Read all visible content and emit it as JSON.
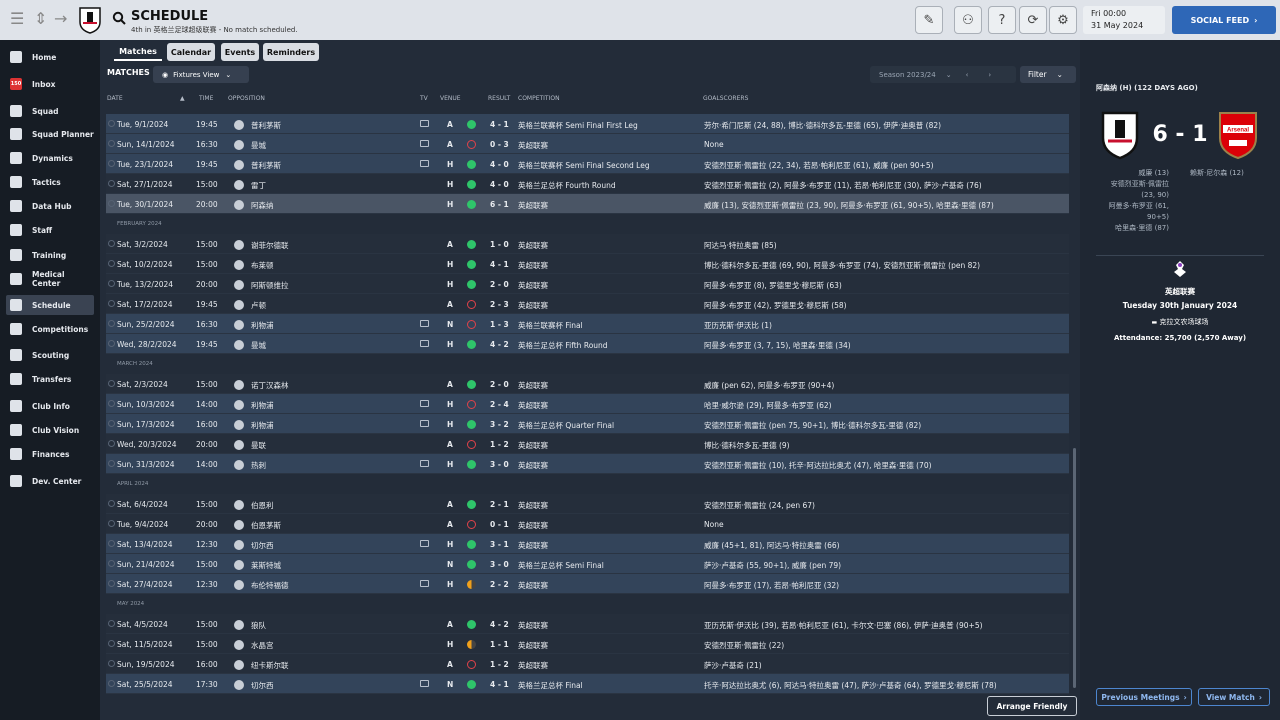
{
  "header": {
    "title": "SCHEDULE",
    "subtitle": "4th in 英格兰足球超级联赛 - No match scheduled.",
    "date_line1": "Fri 00:00",
    "date_line2": "31 May 2024",
    "social_feed": "SOCIAL FEED"
  },
  "sidebar": {
    "items": [
      {
        "label": "Home",
        "icon": "home-icon"
      },
      {
        "label": "Inbox",
        "icon": "inbox-icon"
      },
      {
        "label": "Squad",
        "icon": "shirt-icon"
      },
      {
        "label": "Squad Planner",
        "icon": "planner-icon"
      },
      {
        "label": "Dynamics",
        "icon": "dynamics-icon"
      },
      {
        "label": "Tactics",
        "icon": "tactics-icon"
      },
      {
        "label": "Data Hub",
        "icon": "data-hub-icon"
      },
      {
        "label": "Staff",
        "icon": "staff-icon"
      },
      {
        "label": "Training",
        "icon": "training-icon"
      },
      {
        "label": "Medical Center",
        "icon": "medical-icon"
      },
      {
        "label": "Schedule",
        "icon": "calendar-icon"
      },
      {
        "label": "Competitions",
        "icon": "trophy-icon"
      },
      {
        "label": "Scouting",
        "icon": "scouting-icon"
      },
      {
        "label": "Transfers",
        "icon": "transfers-icon"
      },
      {
        "label": "Club Info",
        "icon": "club-info-icon"
      },
      {
        "label": "Club Vision",
        "icon": "club-vision-icon"
      },
      {
        "label": "Finances",
        "icon": "finances-icon"
      },
      {
        "label": "Dev. Center",
        "icon": "dev-center-icon"
      }
    ],
    "inbox_badge": "150"
  },
  "tabs": [
    "Matches",
    "Calendar",
    "Events",
    "Reminders"
  ],
  "toolbar": {
    "matches_label": "MATCHES",
    "fixtures_view": "Fixtures View",
    "season": "Season 2023/24",
    "filter": "Filter"
  },
  "columns": {
    "date": "DATE",
    "time": "TIME",
    "opposition": "OPPOSITION",
    "tv": "TV",
    "venue": "VENUE",
    "result": "RESULT",
    "competition": "COMPETITION",
    "goalscorers": "GOALSCORERS"
  },
  "matches": [
    {
      "date": "Tue, 9/1/2024",
      "time": "19:45",
      "opp": "普利茅斯",
      "tv": true,
      "venue": "A",
      "outcome": "w",
      "result": "4 - 1",
      "comp": "英格兰联赛杯 Semi Final First Leg",
      "scorers": "劳尔·希门尼斯 (24, 88), 博比·德科尔多瓦-里德 (65), 伊萨·迪奥普 (82)"
    },
    {
      "date": "Sun, 14/1/2024",
      "time": "16:30",
      "opp": "曼城",
      "tv": true,
      "venue": "A",
      "outcome": "l",
      "result": "0 - 3",
      "comp": "英超联赛",
      "scorers": "None"
    },
    {
      "date": "Tue, 23/1/2024",
      "time": "19:45",
      "opp": "普利茅斯",
      "tv": true,
      "venue": "H",
      "outcome": "w",
      "result": "4 - 0",
      "comp": "英格兰联赛杯 Semi Final Second Leg",
      "scorers": "安德烈亚斯·佩雷拉 (22, 34), 若昂·帕利尼亚 (61), 威廉 (pen 90+5)"
    },
    {
      "date": "Sat, 27/1/2024",
      "time": "15:00",
      "opp": "雷丁",
      "tv": false,
      "venue": "H",
      "outcome": "w",
      "result": "4 - 0",
      "comp": "英格兰足总杯 Fourth Round",
      "scorers": "安德烈亚斯·佩雷拉 (2), 阿曼多·布罗亚 (11), 若昂·帕利尼亚 (30), 萨沙·卢基奇 (76)"
    },
    {
      "date": "Tue, 30/1/2024",
      "time": "20:00",
      "opp": "阿森纳",
      "tv": false,
      "venue": "H",
      "outcome": "w",
      "result": "6 - 1",
      "comp": "英超联赛",
      "scorers": "威廉 (13), 安德烈亚斯·佩雷拉 (23, 90), 阿曼多·布罗亚 (61, 90+5), 哈里森·里德 (87)",
      "selected": true
    },
    {
      "section": "FEBRUARY 2024"
    },
    {
      "date": "Sat, 3/2/2024",
      "time": "15:00",
      "opp": "谢菲尔德联",
      "tv": false,
      "venue": "A",
      "outcome": "w",
      "result": "1 - 0",
      "comp": "英超联赛",
      "scorers": "阿达马·特拉奥雷 (85)"
    },
    {
      "date": "Sat, 10/2/2024",
      "time": "15:00",
      "opp": "布莱顿",
      "tv": false,
      "venue": "H",
      "outcome": "w",
      "result": "4 - 1",
      "comp": "英超联赛",
      "scorers": "博比·德科尔多瓦-里德 (69, 90), 阿曼多·布罗亚 (74), 安德烈亚斯·佩雷拉 (pen 82)"
    },
    {
      "date": "Tue, 13/2/2024",
      "time": "20:00",
      "opp": "阿斯顿维拉",
      "tv": false,
      "venue": "H",
      "outcome": "w",
      "result": "2 - 0",
      "comp": "英超联赛",
      "scorers": "阿曼多·布罗亚 (8), 罗德里戈·穆尼斯 (63)"
    },
    {
      "date": "Sat, 17/2/2024",
      "time": "19:45",
      "opp": "卢顿",
      "tv": false,
      "venue": "A",
      "outcome": "l",
      "result": "2 - 3",
      "comp": "英超联赛",
      "scorers": "阿曼多·布罗亚 (42), 罗德里戈·穆尼斯 (58)"
    },
    {
      "date": "Sun, 25/2/2024",
      "time": "16:30",
      "opp": "利物浦",
      "tv": true,
      "venue": "N",
      "outcome": "l",
      "result": "1 - 3",
      "comp": "英格兰联赛杯 Final",
      "scorers": "亚历克斯·伊沃比 (1)"
    },
    {
      "date": "Wed, 28/2/2024",
      "time": "19:45",
      "opp": "曼城",
      "tv": true,
      "venue": "H",
      "outcome": "w",
      "result": "4 - 2",
      "comp": "英格兰足总杯 Fifth Round",
      "scorers": "阿曼多·布罗亚 (3, 7, 15), 哈里森·里德 (34)"
    },
    {
      "section": "MARCH 2024"
    },
    {
      "date": "Sat, 2/3/2024",
      "time": "15:00",
      "opp": "诺丁汉森林",
      "tv": false,
      "venue": "A",
      "outcome": "w",
      "result": "2 - 0",
      "comp": "英超联赛",
      "scorers": "威廉 (pen 62), 阿曼多·布罗亚 (90+4)"
    },
    {
      "date": "Sun, 10/3/2024",
      "time": "14:00",
      "opp": "利物浦",
      "tv": true,
      "venue": "H",
      "outcome": "l",
      "result": "2 - 4",
      "comp": "英超联赛",
      "scorers": "哈里·威尔逊 (29), 阿曼多·布罗亚 (62)"
    },
    {
      "date": "Sun, 17/3/2024",
      "time": "16:00",
      "opp": "利物浦",
      "tv": true,
      "venue": "H",
      "outcome": "w",
      "result": "3 - 2",
      "comp": "英格兰足总杯 Quarter Final",
      "scorers": "安德烈亚斯·佩雷拉 (pen 75, 90+1), 博比·德科尔多瓦-里德 (82)"
    },
    {
      "date": "Wed, 20/3/2024",
      "time": "20:00",
      "opp": "曼联",
      "tv": false,
      "venue": "A",
      "outcome": "l",
      "result": "1 - 2",
      "comp": "英超联赛",
      "scorers": "博比·德科尔多瓦-里德 (9)"
    },
    {
      "date": "Sun, 31/3/2024",
      "time": "14:00",
      "opp": "热刺",
      "tv": true,
      "venue": "H",
      "outcome": "w",
      "result": "3 - 0",
      "comp": "英超联赛",
      "scorers": "安德烈亚斯·佩雷拉 (10), 托辛·阿达拉比奥尤 (47), 哈里森·里德 (70)"
    },
    {
      "section": "APRIL 2024"
    },
    {
      "date": "Sat, 6/4/2024",
      "time": "15:00",
      "opp": "伯恩利",
      "tv": false,
      "venue": "A",
      "outcome": "w",
      "result": "2 - 1",
      "comp": "英超联赛",
      "scorers": "安德烈亚斯·佩雷拉 (24, pen 67)"
    },
    {
      "date": "Tue, 9/4/2024",
      "time": "20:00",
      "opp": "伯恩茅斯",
      "tv": false,
      "venue": "A",
      "outcome": "l",
      "result": "0 - 1",
      "comp": "英超联赛",
      "scorers": "None"
    },
    {
      "date": "Sat, 13/4/2024",
      "time": "12:30",
      "opp": "切尔西",
      "tv": true,
      "venue": "H",
      "outcome": "w",
      "result": "3 - 1",
      "comp": "英超联赛",
      "scorers": "威廉 (45+1, 81), 阿达马·特拉奥雷 (66)"
    },
    {
      "date": "Sun, 21/4/2024",
      "time": "15:00",
      "opp": "莱斯特城",
      "tv": false,
      "venue": "N",
      "outcome": "w",
      "result": "3 - 0",
      "comp": "英格兰足总杯 Semi Final",
      "scorers": "萨沙·卢基奇 (55, 90+1), 威廉 (pen 79)"
    },
    {
      "date": "Sat, 27/4/2024",
      "time": "12:30",
      "opp": "布伦特福德",
      "tv": true,
      "venue": "H",
      "outcome": "d",
      "result": "2 - 2",
      "comp": "英超联赛",
      "scorers": "阿曼多·布罗亚 (17), 若昂·帕利尼亚 (32)"
    },
    {
      "section": "MAY 2024"
    },
    {
      "date": "Sat, 4/5/2024",
      "time": "15:00",
      "opp": "狼队",
      "tv": false,
      "venue": "A",
      "outcome": "w",
      "result": "4 - 2",
      "comp": "英超联赛",
      "scorers": "亚历克斯·伊沃比 (39), 若昂·帕利尼亚 (61), 卡尔文·巴塞 (86), 伊萨·迪奥普 (90+5)"
    },
    {
      "date": "Sat, 11/5/2024",
      "time": "15:00",
      "opp": "水晶宫",
      "tv": false,
      "venue": "H",
      "outcome": "d",
      "result": "1 - 1",
      "comp": "英超联赛",
      "scorers": "安德烈亚斯·佩雷拉 (22)"
    },
    {
      "date": "Sun, 19/5/2024",
      "time": "16:00",
      "opp": "纽卡斯尔联",
      "tv": false,
      "venue": "A",
      "outcome": "l",
      "result": "1 - 2",
      "comp": "英超联赛",
      "scorers": "萨沙·卢基奇 (21)"
    },
    {
      "date": "Sat, 25/5/2024",
      "time": "17:30",
      "opp": "切尔西",
      "tv": true,
      "venue": "N",
      "outcome": "w",
      "result": "4 - 1",
      "comp": "英格兰足总杯 Final",
      "scorers": "托辛·阿达拉比奥尤 (6), 阿达马·特拉奥雷 (47), 萨沙·卢基奇 (64), 罗德里戈·穆尼斯 (78)"
    }
  ],
  "arrange_friendly": "Arrange Friendly",
  "right_panel": {
    "title": "阿森纳 (H) (122 DAYS AGO)",
    "score": "6 - 1",
    "away_crest_text": "Arsenal",
    "home_scorers": [
      "威廉 (13)",
      "安德烈亚斯·佩雷拉",
      "(23, 90)",
      "阿曼多·布罗亚 (61,",
      "90+5)",
      "哈里森·里德 (87)"
    ],
    "away_scorers": [
      "赖斯·尼尔森 (12)"
    ],
    "competition": "英超联赛",
    "date": "Tuesday 30th January 2024",
    "stadium": "克拉文农场球场",
    "attendance": "Attendance: 25,700 (2,570 Away)",
    "previous_meetings": "Previous Meetings",
    "view_match": "View Match"
  },
  "colors": {
    "win": "#2fc56a",
    "loss": "#e0424a",
    "draw": "#f0a01b",
    "accent": "#2e67b7"
  }
}
